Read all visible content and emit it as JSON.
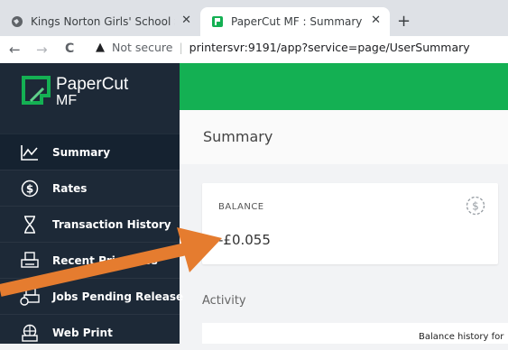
{
  "browser": {
    "tabs": [
      {
        "title": "Kings Norton Girls' School Speed",
        "close": "✕"
      },
      {
        "title": "PaperCut MF : Summary",
        "close": "✕"
      }
    ],
    "new_tab": "+",
    "nav": {
      "back": "←",
      "forward": "→",
      "reload": "C"
    },
    "security_text": "Not secure",
    "url": "printersvr:9191/app?service=page/UserSummary"
  },
  "logo": {
    "line1": "PaperCut",
    "line2": "MF"
  },
  "sidebar": {
    "items": [
      {
        "label": "Summary",
        "icon": "chart-line-icon"
      },
      {
        "label": "Rates",
        "icon": "dollar-circle-icon"
      },
      {
        "label": "Transaction History",
        "icon": "hourglass-icon"
      },
      {
        "label": "Recent Print Jobs",
        "icon": "printer-icon"
      },
      {
        "label": "Jobs Pending Release",
        "icon": "pending-printer-icon"
      },
      {
        "label": "Web Print",
        "icon": "web-print-icon"
      }
    ]
  },
  "main": {
    "title": "Summary",
    "balance_label": "BALANCE",
    "balance_value": "-£0.055",
    "activity_label": "Activity",
    "balance_history_label": "Balance history for"
  },
  "colors": {
    "sidebar": "#1d2937",
    "green": "#14b053",
    "arrow": "#e57c2f"
  }
}
